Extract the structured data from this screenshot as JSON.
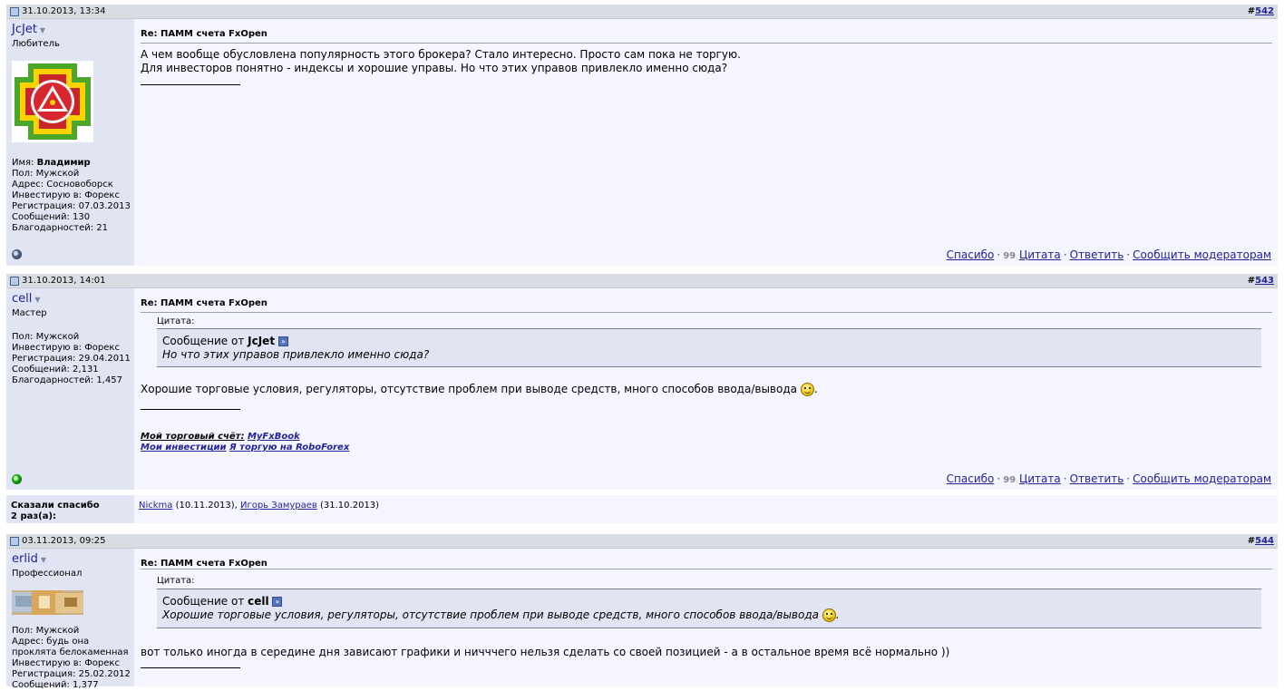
{
  "posts": [
    {
      "date": "31.10.2013, 13:34",
      "number_prefix": "#",
      "number": "542",
      "user": {
        "name": "JcJet",
        "rank": "Любитель",
        "info": [
          "Имя: ",
          "Пол: Мужской",
          "Адрес: Сосновоборск",
          "Инвестирую в: Форекс",
          "Регистрация: 07.03.2013",
          "Сообщений: 130",
          "Благодарностей: 21"
        ],
        "real_name": "Владимир",
        "status": "offline"
      },
      "title": "Re: ПАММ счета FxOpen",
      "lines": [
        "А чем вообще обусловлена популярность этого брокера? Стало интересно. Просто сам пока не торгую.",
        "Для инвесторов понятно - индексы и хорошие управы. Но что этих управов привлекло именно сюда?"
      ]
    },
    {
      "date": "31.10.2013, 14:01",
      "number_prefix": "#",
      "number": "543",
      "user": {
        "name": "cell",
        "rank": "Мастер",
        "info": [
          "Пол: Мужской",
          "Инвестирую в: Форекс",
          "Регистрация: 29.04.2011",
          "Сообщений: 2,131",
          "Благодарностей: 1,457"
        ],
        "status": "online"
      },
      "title": "Re: ПАММ счета FxOpen",
      "quote_label": "Цитата:",
      "quote_from": "Сообщение от ",
      "quote_author": "JcJet",
      "quote_text": "Но что этих управов привлекло именно сюда?",
      "text": "Хорошие торговые условия, регуляторы, отсутствие проблем при выводе средств, много способов ввода/вывода",
      "text_end": ".",
      "sig_line1_prefix": "Мой торговый счёт:",
      "sig_line1_link": "MyFxBook",
      "sig_line2_a": "Мои инвестиции",
      "sig_line2_b": "Я торгую на RoboForex"
    },
    {
      "date": "03.11.2013, 09:25",
      "number_prefix": "#",
      "number": "544",
      "user": {
        "name": "erlid",
        "rank": "Профессионал",
        "info": [
          "Пол: Мужской",
          "Адрес: будь она",
          "проклята белокаменная",
          "Инвестирую в: Форекс",
          "Регистрация: 25.02.2012",
          "Сообщений: 1,377"
        ],
        "status": "offline"
      },
      "title": "Re: ПАММ счета FxOpen",
      "quote_label": "Цитата:",
      "quote_from": "Сообщение от ",
      "quote_author": "cell",
      "quote_text": "Хорошие торговые условия, регуляторы, отсутствие проблем при выводе средств, много способов ввода/вывода",
      "quote_end": ".",
      "text": "вот только иногда в середине дня зависают графики и ничччего нельзя сделать со своей позицией - а в остальное время всё нормально ))"
    }
  ],
  "actions": {
    "thanks": "Спасибо",
    "quote": "Цитата",
    "reply": "Ответить",
    "report": "Сообщить модераторам",
    "dot": "·",
    "quote_glyph": "99"
  },
  "thanks_block": {
    "label_line1": "Сказали спасибо",
    "label_line2": "2 раз(а):",
    "user1": "Nickma",
    "date1": " (10.11.2013), ",
    "user2": "Игорь Замураев",
    "date2": " (31.10.2013)"
  },
  "colors": {
    "link": "#22229c",
    "user_panel": "#e1e4f2",
    "content_bg": "#f5f5ff",
    "header_bg": "#d8dde3"
  }
}
